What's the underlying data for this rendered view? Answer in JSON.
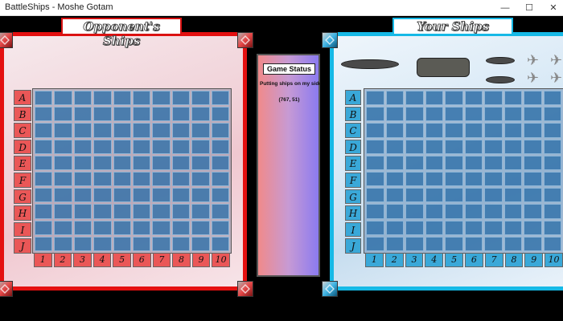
{
  "window": {
    "title": "BattleShips - Moshe Gotam",
    "minimize_icon": "minimize-icon",
    "maximize_icon": "maximize-icon",
    "close_icon": "close-icon"
  },
  "opponent_board": {
    "title": "Opponent's Ships",
    "accent_color": "#e41010",
    "rows": [
      "A",
      "B",
      "C",
      "D",
      "E",
      "F",
      "G",
      "H",
      "I",
      "J"
    ],
    "columns": [
      "1",
      "2",
      "3",
      "4",
      "5",
      "6",
      "7",
      "8",
      "9",
      "10"
    ]
  },
  "your_board": {
    "title": "Your Ships",
    "accent_color": "#16b9e6",
    "rows": [
      "A",
      "B",
      "C",
      "D",
      "E",
      "F",
      "G",
      "H",
      "I",
      "J"
    ],
    "columns": [
      "1",
      "2",
      "3",
      "4",
      "5",
      "6",
      "7",
      "8",
      "9",
      "10"
    ]
  },
  "status_panel": {
    "header": "Game Status",
    "message": "Putting ships on my side",
    "coordinates": "(767, 51)"
  },
  "ship_tray": {
    "items": [
      "battleship-icon",
      "carrier-icon",
      "destroyer-icon",
      "submarine-icon",
      "fighter-jet-icon"
    ]
  }
}
